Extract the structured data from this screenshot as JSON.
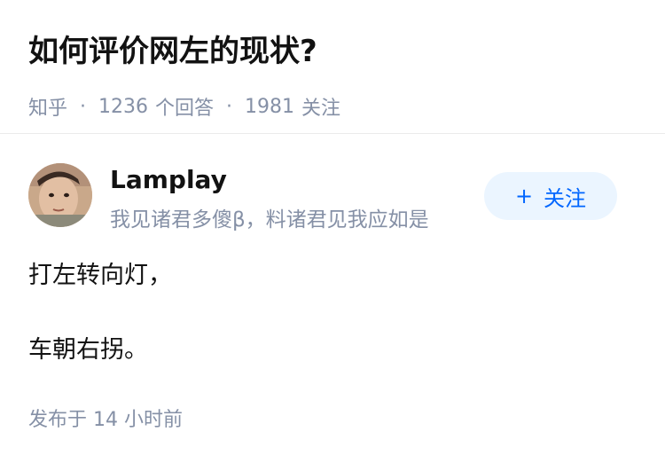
{
  "question": {
    "title": "如何评价网左的现状?",
    "source": "知乎",
    "separator": "·",
    "answer_count": "1236",
    "answer_label": "个回答",
    "follower_count": "1981",
    "follower_label": "关注"
  },
  "author": {
    "avatar_icon": "avatar-photo-child",
    "name": "Lamplay",
    "bio": "我见诸君多傻β，料诸君见我应如是",
    "follow_plus": "+",
    "follow_label": "关注"
  },
  "answer": {
    "paragraphs": [
      "打左转向灯，",
      "车朝右拐。"
    ],
    "publish_time": "发布于  14 小时前"
  },
  "colors": {
    "meta_gray": "#8590a6",
    "follow_blue": "#0066ff",
    "follow_bg": "#ebf5ff"
  }
}
